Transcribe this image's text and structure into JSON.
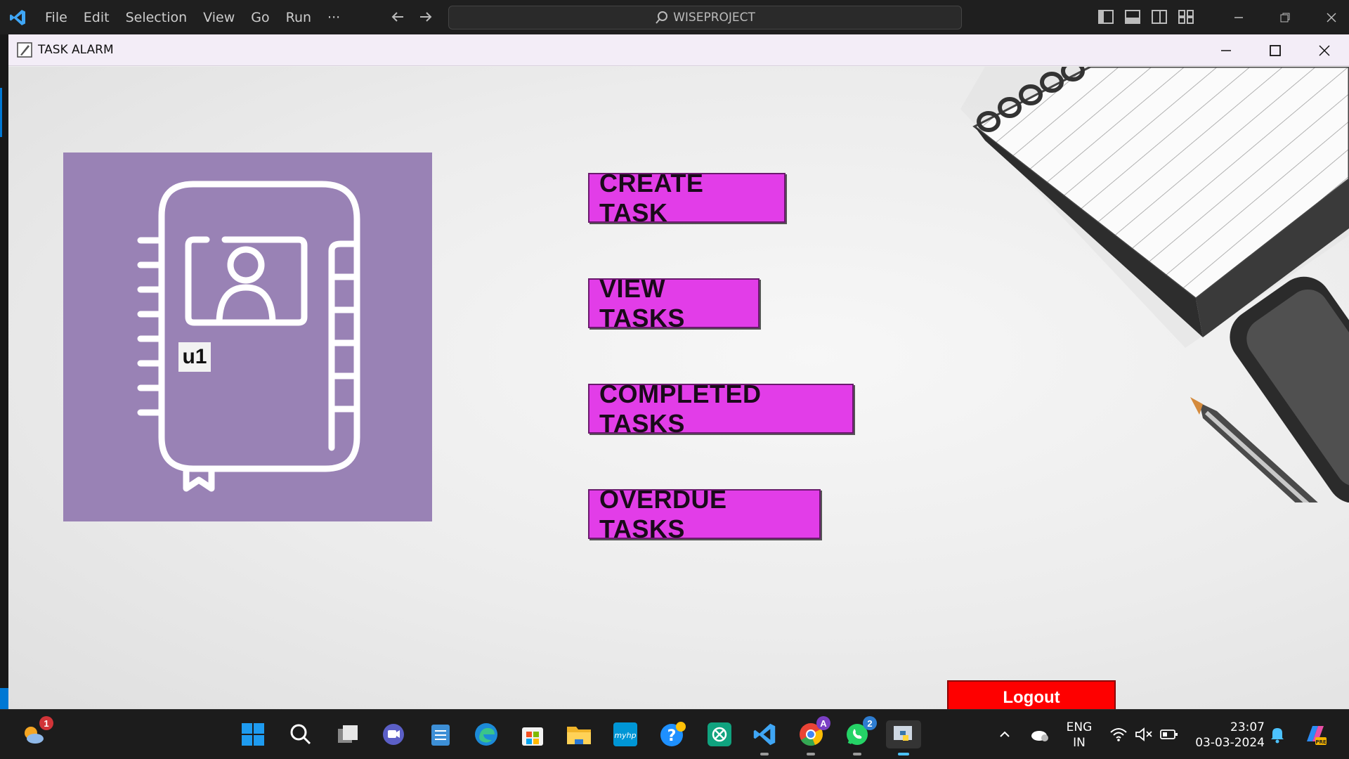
{
  "vscode": {
    "menu": [
      "File",
      "Edit",
      "Selection",
      "View",
      "Go",
      "Run",
      "···"
    ],
    "search_text": "WISEPROJECT"
  },
  "window": {
    "title": "TASK ALARM"
  },
  "profile": {
    "username": "u1"
  },
  "actions": {
    "create": "CREATE TASK",
    "view": "VIEW TASKS",
    "completed": "COMPLETED TASKS",
    "overdue": "OVERDUE TASKS",
    "logout": "Logout"
  },
  "colors": {
    "button_bg": "#e23de8",
    "logout_bg": "#fe0000",
    "logo_card_bg": "#9982b5"
  },
  "taskbar": {
    "weather_badge": "1",
    "chrome_badge": "A",
    "whatsapp_badge": "2",
    "language_top": "ENG",
    "language_bottom": "IN",
    "time": "23:07",
    "date": "03-03-2024",
    "icons": [
      "weather-icon",
      "start-icon",
      "search-icon",
      "task-view-icon",
      "teams-icon",
      "notepad-icon",
      "edge-icon",
      "store-icon",
      "file-explorer-icon",
      "myhp-icon",
      "help-icon",
      "chatgpt-icon",
      "vscode-icon",
      "chrome-icon",
      "whatsapp-icon",
      "python-icon"
    ]
  }
}
